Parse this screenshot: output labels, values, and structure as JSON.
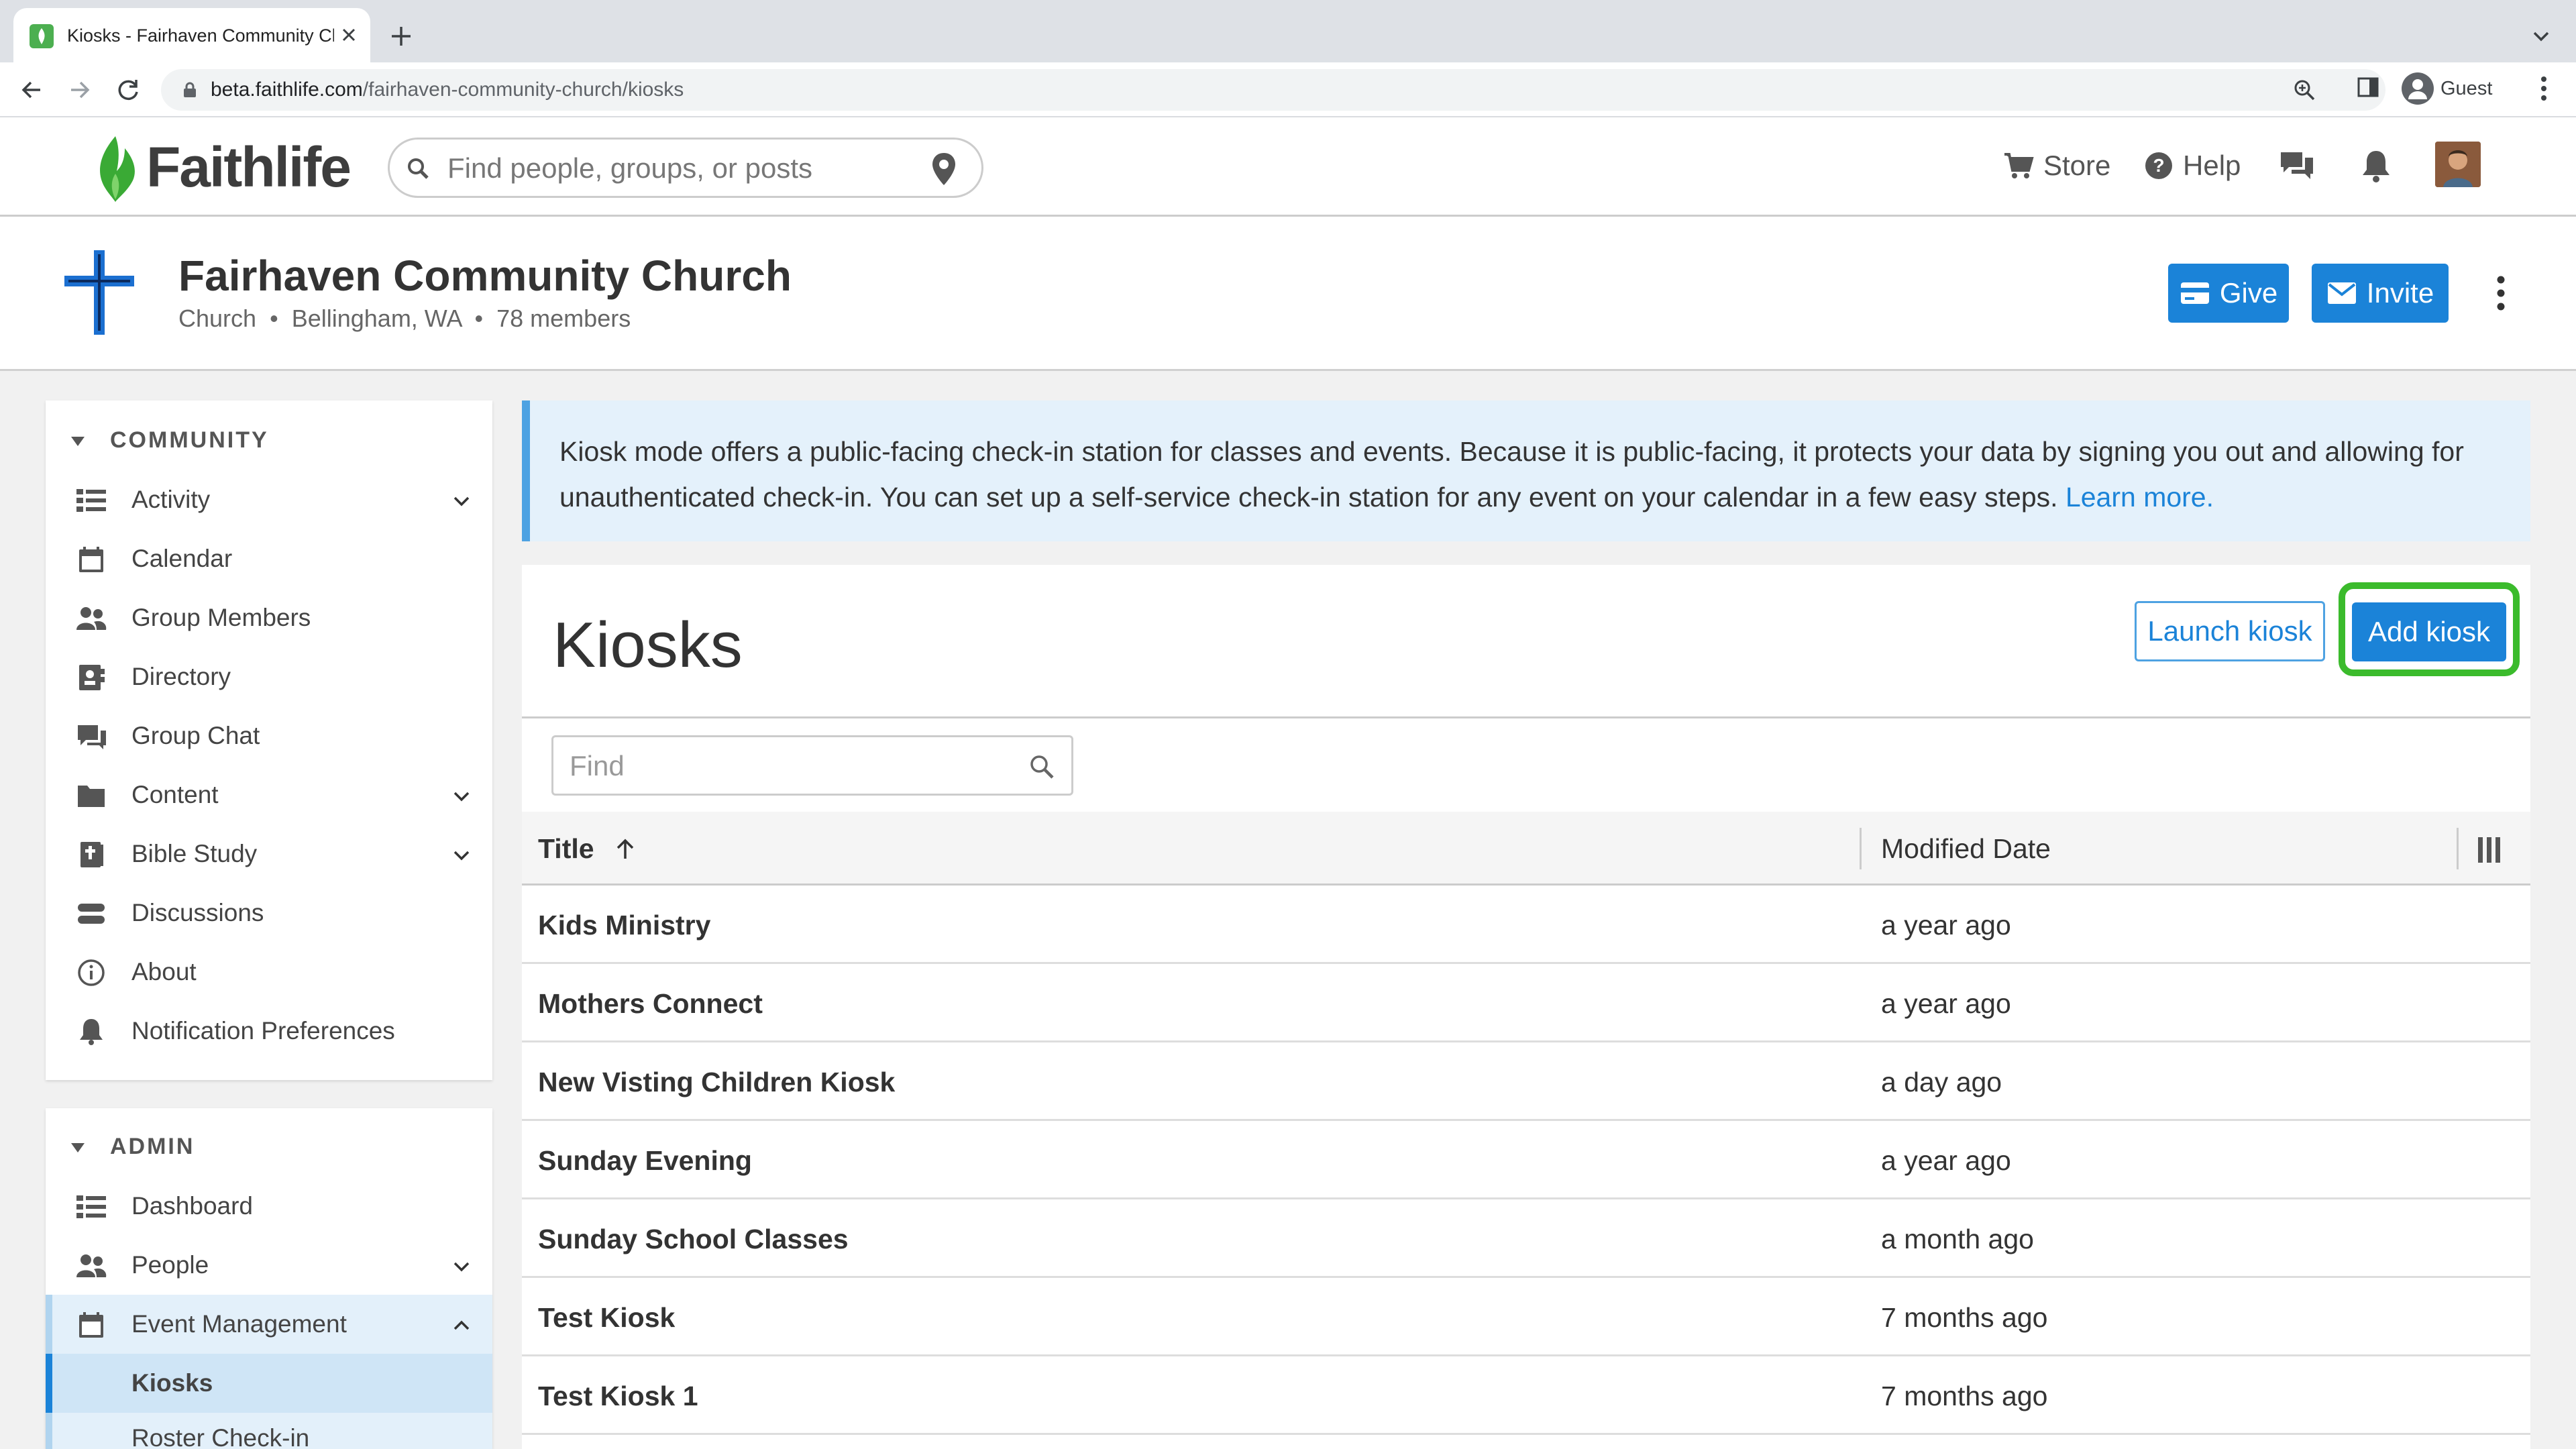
{
  "browser": {
    "tab_title": "Kiosks - Fairhaven Community Church",
    "url_host": "beta.faithlife.com",
    "url_path": "/fairhaven-community-church/kiosks",
    "profile_label": "Guest"
  },
  "site_header": {
    "logo_text": "Faithlife",
    "search_placeholder": "Find people, groups, or posts",
    "store_label": "Store",
    "help_label": "Help"
  },
  "group": {
    "name": "Fairhaven Community Church",
    "type": "Church",
    "location": "Bellingham, WA",
    "members": "78 members",
    "give_label": "Give",
    "invite_label": "Invite"
  },
  "sidebar": {
    "community_heading": "COMMUNITY",
    "community_items": [
      {
        "label": "Activity",
        "icon": "activity-icon",
        "expandable": true
      },
      {
        "label": "Calendar",
        "icon": "calendar-icon",
        "expandable": false
      },
      {
        "label": "Group Members",
        "icon": "people-icon",
        "expandable": false
      },
      {
        "label": "Directory",
        "icon": "directory-icon",
        "expandable": false
      },
      {
        "label": "Group Chat",
        "icon": "chat-icon",
        "expandable": false
      },
      {
        "label": "Content",
        "icon": "folder-icon",
        "expandable": true
      },
      {
        "label": "Bible Study",
        "icon": "bible-icon",
        "expandable": true
      },
      {
        "label": "Discussions",
        "icon": "discussions-icon",
        "expandable": false
      },
      {
        "label": "About",
        "icon": "info-icon",
        "expandable": false
      },
      {
        "label": "Notification Preferences",
        "icon": "bell-icon",
        "expandable": false
      }
    ],
    "admin_heading": "ADMIN",
    "admin_items": [
      {
        "label": "Dashboard",
        "icon": "dashboard-icon"
      },
      {
        "label": "People",
        "icon": "people-icon"
      },
      {
        "label": "Event Management",
        "icon": "calendar-icon"
      },
      {
        "label": "Kiosks"
      },
      {
        "label": "Roster Check-in"
      }
    ]
  },
  "banner": {
    "text": "Kiosk mode offers a public-facing check-in station for classes and events. Because it is public-facing, it protects your data by signing you out and allowing for unauthenticated check-in. You can set up a self-service check-in station for any event on your calendar in a few easy steps.",
    "link_label": "Learn more."
  },
  "kiosks": {
    "title": "Kiosks",
    "launch_label": "Launch kiosk",
    "add_label": "Add kiosk",
    "find_placeholder": "Find",
    "col_title": "Title",
    "col_modified": "Modified Date",
    "rows": [
      {
        "title": "Kids Ministry",
        "modified": "a year ago"
      },
      {
        "title": "Mothers Connect",
        "modified": "a year ago"
      },
      {
        "title": "New Visting Children Kiosk",
        "modified": "a day ago"
      },
      {
        "title": "Sunday Evening",
        "modified": "a year ago"
      },
      {
        "title": "Sunday School Classes",
        "modified": "a month ago"
      },
      {
        "title": "Test Kiosk",
        "modified": "7 months ago"
      },
      {
        "title": "Test Kiosk 1",
        "modified": "7 months ago"
      }
    ]
  },
  "colors": {
    "accent": "#1b83d8",
    "highlight": "#3bbb2c",
    "banner_bg": "#e4f1fb"
  }
}
